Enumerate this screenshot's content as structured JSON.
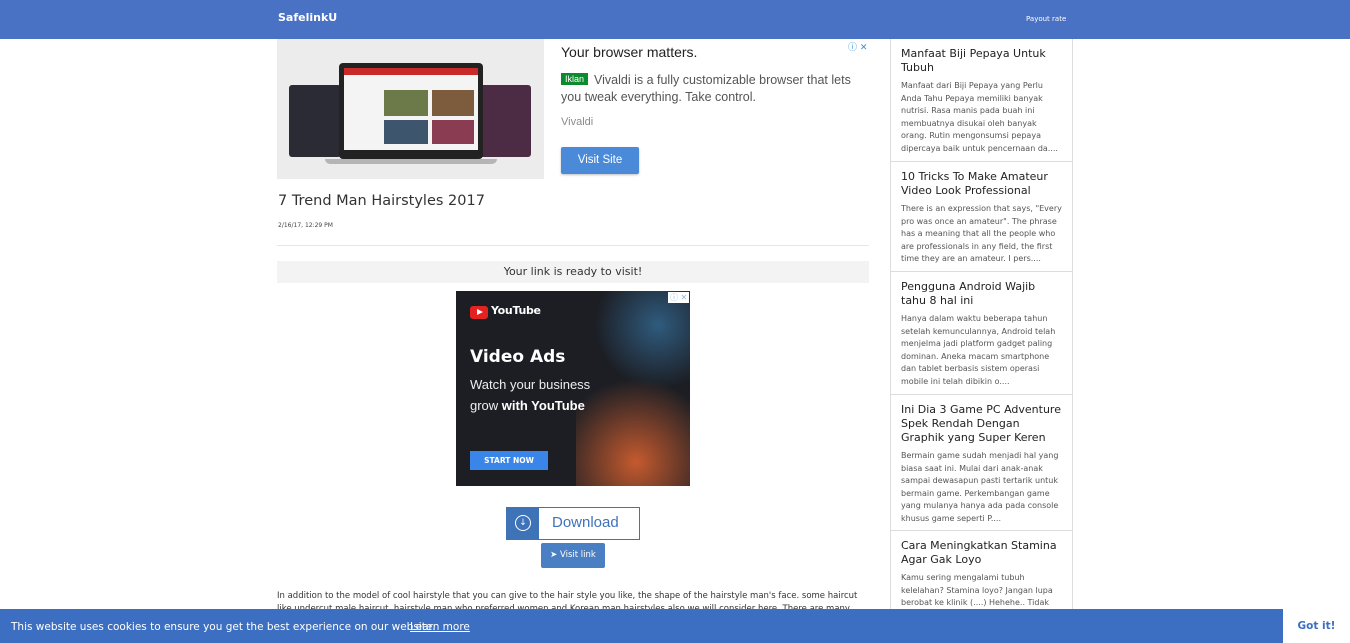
{
  "header": {
    "brand": "SafelinkU",
    "payout_label": "Payout rate"
  },
  "top_ad": {
    "title": "Your browser matters.",
    "badge": "Iklan",
    "description": "Vivaldi is a fully customizable browser that lets you tweak everything. Take control.",
    "source": "Vivaldi",
    "button": "Visit Site",
    "adchoices": "ⓘ ✕"
  },
  "post": {
    "title": "7 Trend Man Hairstyles 2017",
    "date": "2/16/17, 12:29 PM",
    "ready_text": "Your link is ready to visit!"
  },
  "yt_ad": {
    "brand": "YouTube",
    "headline": "Video Ads",
    "line1": "Watch your business",
    "line2_prefix": "grow ",
    "line2_bold": "with YouTube",
    "button": "START NOW",
    "adchoices": "ⓘ ✕"
  },
  "download": {
    "label": "Download",
    "icon": "download-icon",
    "visit_label": "Visit link",
    "visit_icon": "paper-plane-icon"
  },
  "article": {
    "text": "In addition to the model of cool hairstyle that you can give to the hair style you like, the shape of the hairstyle man's face. some haircut like undercut male haircut, hairstyle man who preferred women and Korean man hairstyles also we will consider here. There are many other"
  },
  "sidebar": {
    "cards": [
      {
        "title": "Manfaat Biji Pepaya Untuk Tubuh",
        "text": "Manfaat dari Biji Pepaya yang Perlu Anda Tahu Pepaya memiliki banyak nutrisi. Rasa manis pada buah ini membuatnya disukai oleh banyak orang. Rutin mengonsumsi pepaya dipercaya baik untuk pencernaan da...."
      },
      {
        "title": "10 Tricks To Make Amateur Video Look Professional",
        "text": "There is an expression that says, \"Every pro was once an amateur\". The phrase has a meaning that all the people who are professionals in any field, the first time they are an amateur. I pers...."
      },
      {
        "title": "Pengguna Android Wajib tahu 8 hal ini",
        "text": "Hanya dalam waktu beberapa tahun setelah kemunculannya, Android telah menjelma jadi platform gadget paling dominan. Aneka macam smartphone dan tablet berbasis sistem operasi mobile ini telah dibikin o...."
      },
      {
        "title": "Ini Dia 3 Game PC Adventure Spek Rendah Dengan Graphik yang Super Keren",
        "text": "Bermain game sudah menjadi hal yang biasa saat ini. Mulai dari anak-anak sampai dewasapun pasti tertarik untuk bermain game. Perkembangan game yang mulanya hanya ada pada console khusus game seperti P...."
      },
      {
        "title": "Cara Meningkatkan Stamina Agar Gak Loyo",
        "text": "Kamu sering mengalami tubuh kelelahan? Stamina loyo? Jangan lupa berobat ke klinik (....) Hehehe.. Tidak"
      }
    ]
  },
  "cookie": {
    "message": "This website uses cookies to ensure you get the best experience on our website.",
    "link": "Learn more",
    "button": "Got it!"
  },
  "colors": {
    "header_bg": "#4a72c4",
    "cookie_bg": "#3c6fc1",
    "ad_button": "#4a8ad8",
    "ad_badge": "#0c8a2d"
  }
}
